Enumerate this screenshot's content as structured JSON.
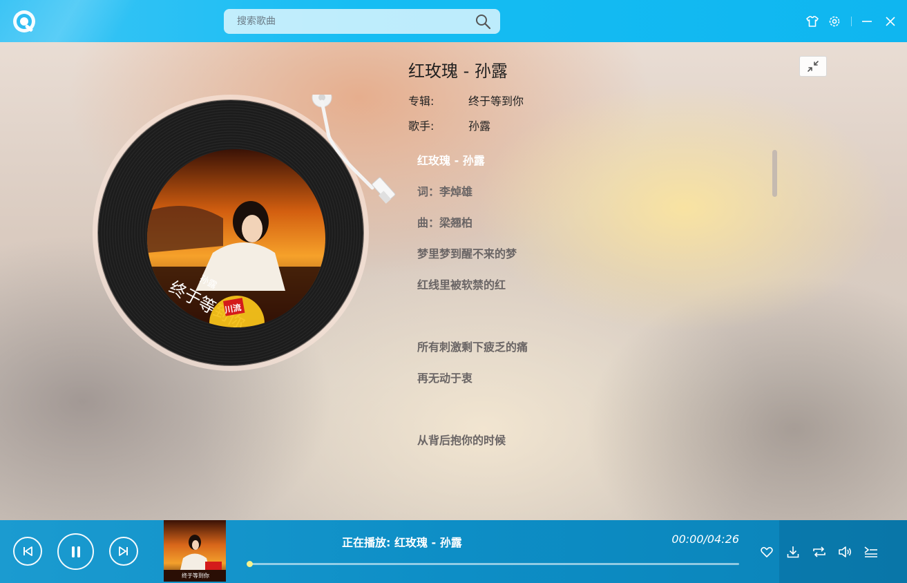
{
  "header": {
    "logo": "qq-music-logo",
    "search": {
      "placeholder": "搜索歌曲",
      "value": ""
    },
    "icons": [
      "skin-shirt-icon",
      "gear-icon",
      "minimize-icon",
      "close-icon"
    ]
  },
  "song": {
    "title": "红玫瑰 - 孙露",
    "album_label": "专辑:",
    "album": "终于等到你",
    "singer_label": "歌手:",
    "singer": "孙露"
  },
  "lyrics": [
    {
      "text": "红玫瑰 - 孙露",
      "current": true
    },
    {
      "text": "词：李焯雄"
    },
    {
      "text": "曲：梁翘柏"
    },
    {
      "text": "梦里梦到醒不来的梦"
    },
    {
      "text": "红线里被软禁的红"
    },
    {
      "text": ""
    },
    {
      "text": "所有刺激剩下疲乏的痛"
    },
    {
      "text": "再无动于衷"
    },
    {
      "text": ""
    },
    {
      "text": "从背后抱你的时候"
    }
  ],
  "cover_text": {
    "title": "终于等到你",
    "artist": "孙露",
    "badge": "川流"
  },
  "player": {
    "now_playing": "正在播放: 红玫瑰 - 孙露",
    "time": "00:00/04:26",
    "progress_fraction": 0.0,
    "state": "playing",
    "icons": [
      "previous-icon",
      "pause-icon",
      "next-icon",
      "heart-icon",
      "download-icon",
      "repeat-icon",
      "volume-icon",
      "playlist-icon"
    ]
  },
  "colors": {
    "topbar": "#16bdf3",
    "player_bar": "#0d8ec6",
    "progress_knob": "#f6f28c"
  }
}
